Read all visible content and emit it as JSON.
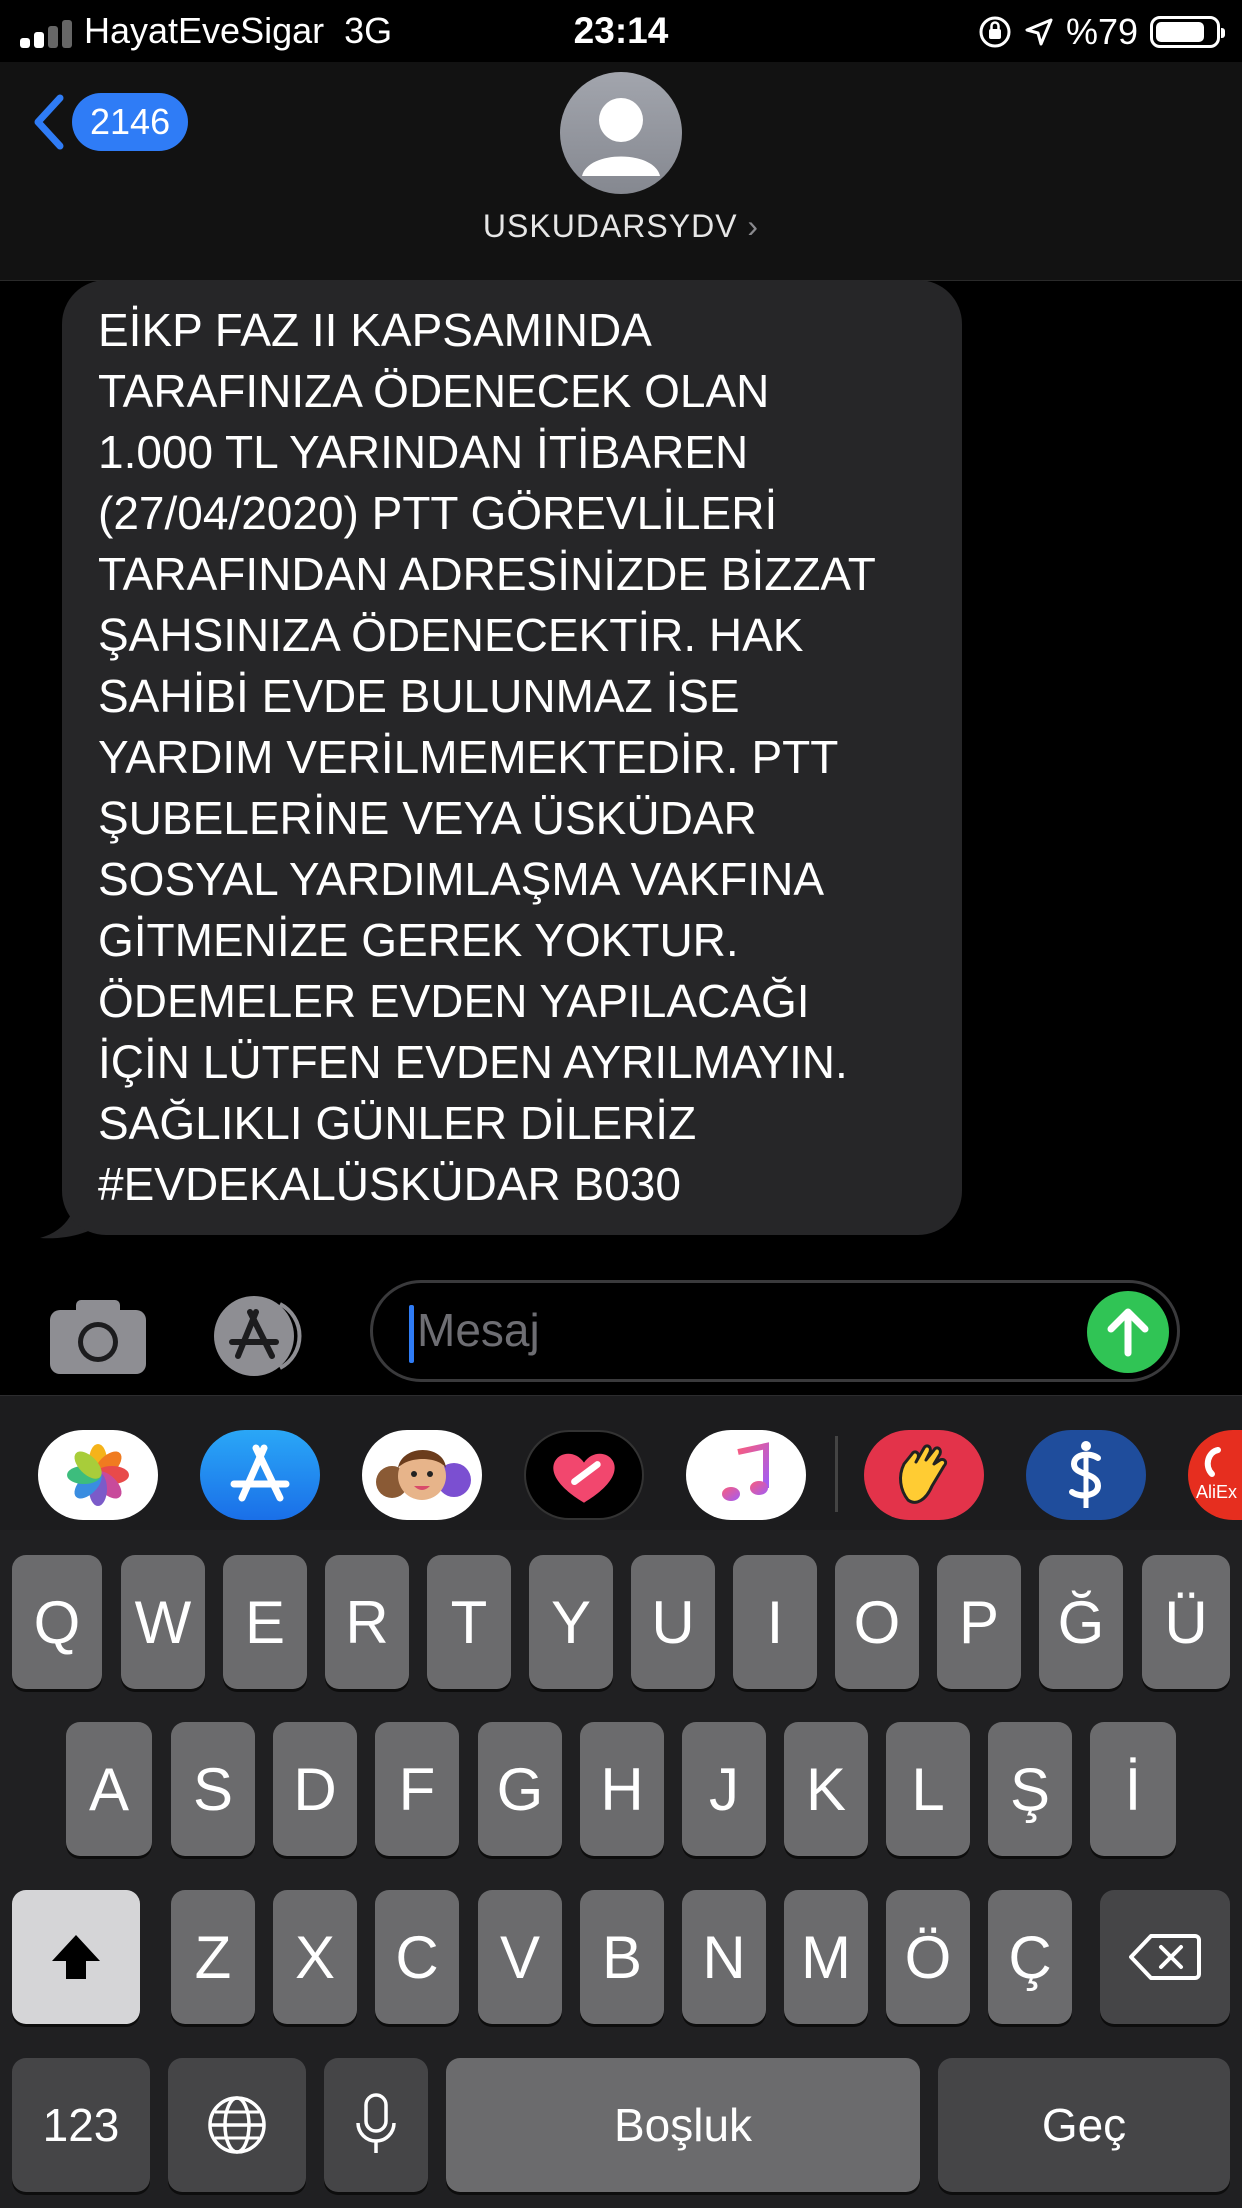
{
  "status_bar": {
    "carrier": "HayatEveSigar",
    "network": "3G",
    "time": "23:14",
    "battery": "%79"
  },
  "header": {
    "back_count": "2146",
    "contact_name": "USKUDARSYDV",
    "contact_chevron": "›"
  },
  "message": {
    "text": "EİKP FAZ II KAPSAMINDA\nTARAFINIZA ÖDENECEK OLAN\n1.000 TL YARINDAN İTİBAREN\n(27/04/2020) PTT GÖREVLİLERİ\nTARAFINDAN ADRESİNİZDE BİZZAT\nŞAHSINIZA ÖDENECEKTİR. HAK\nSAHİBİ EVDE BULUNMAZ İSE\nYARDIM VERİLMEMEKTEDİR. PTT\nŞUBELERİNE VEYA ÜSKÜDAR\nSOSYAL YARDIMLAŞMA VAKFINA\nGİTMENİZE GEREK YOKTUR.\nÖDEMELER EVDEN YAPILACAĞI\nİÇİN LÜTFEN EVDEN AYRILMAYIN.\nSAĞLIKLI GÜNLER DİLERİZ\n#EVDEKALÜSKÜDAR B030"
  },
  "composer": {
    "placeholder": "Mesaj"
  },
  "app_drawer": {
    "apps": [
      {
        "name": "photos-app-icon"
      },
      {
        "name": "app-store-app-icon"
      },
      {
        "name": "memoji-app-icon"
      },
      {
        "name": "digital-touch-app-icon"
      },
      {
        "name": "music-app-icon"
      },
      {
        "name": "wave-app-icon"
      },
      {
        "name": "isbank-app-icon"
      },
      {
        "name": "aliexpress-app-icon",
        "label": "AliEx"
      }
    ]
  },
  "keyboard": {
    "row1": [
      "Q",
      "W",
      "E",
      "R",
      "T",
      "Y",
      "U",
      "I",
      "O",
      "P",
      "Ğ",
      "Ü"
    ],
    "row2": [
      "A",
      "S",
      "D",
      "F",
      "G",
      "H",
      "J",
      "K",
      "L",
      "Ş",
      "İ"
    ],
    "row3": [
      "Z",
      "X",
      "C",
      "V",
      "B",
      "N",
      "M",
      "Ö",
      "Ç"
    ],
    "numbers_label": "123",
    "space_label": "Boşluk",
    "return_label": "Geç"
  },
  "colors": {
    "accent_blue": "#2f7cf6",
    "send_green": "#30c455",
    "bubble": "#262628",
    "key": "#6b6b6d",
    "key_dark": "#454547"
  }
}
